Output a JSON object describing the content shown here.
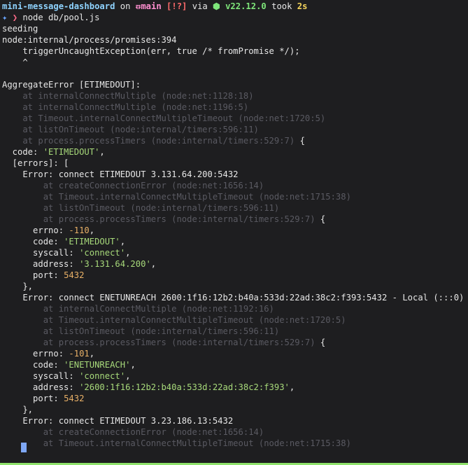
{
  "prompt": {
    "dir": "mini-message-dashboard",
    "on": " on ",
    "branch_icon": "ᵿ",
    "branch": "main",
    "status": "[!?]",
    "via": " via ",
    "node_icon": "⬢",
    "node_version": "v22.12.0",
    "took_label": " took ",
    "took": "2s",
    "star": "✦",
    "arrow": "❯",
    "command": "node db/pool.js"
  },
  "output": {
    "seeding": "seeding",
    "location": "node:internal/process/promises:394",
    "trigger": "    triggerUncaughtException(err, true /* fromPromise */);",
    "caret": "    ^",
    "blank": "",
    "aggregate": "AggregateError [ETIMEDOUT]:",
    "agg_stack": [
      "    at internalConnectMultiple (node:net:1128:18)",
      "    at internalConnectMultiple (node:net:1196:5)",
      "    at Timeout.internalConnectMultipleTimeout (node:net:1720:5)",
      "    at listOnTimeout (node:internal/timers:596:11)"
    ],
    "agg_last": "    at process.processTimers (node:internal/timers:529:7)",
    "open_brace": " {",
    "code_key": "  code: ",
    "code_val": "'ETIMEDOUT'",
    "comma": ",",
    "errors_open": "  [errors]: [",
    "err1": {
      "head": "    Error: connect ETIMEDOUT 3.131.64.200:5432",
      "stack": [
        "        at createConnectionError (node:net:1656:14)",
        "        at Timeout.internalConnectMultipleTimeout (node:net:1715:38)",
        "        at listOnTimeout (node:internal/timers:596:11)"
      ],
      "last": "        at process.processTimers (node:internal/timers:529:7)",
      "errno_key": "      errno: ",
      "errno_val": "-110",
      "code_key": "      code: ",
      "code_val": "'ETIMEDOUT'",
      "syscall_key": "      syscall: ",
      "syscall_val": "'connect'",
      "address_key": "      address: ",
      "address_val": "'3.131.64.200'",
      "port_key": "      port: ",
      "port_val": "5432",
      "close": "    },"
    },
    "err2": {
      "head": "    Error: connect ENETUNREACH 2600:1f16:12b2:b40a:533d:22ad:38c2:f393:5432 - Local (:::0)",
      "stack": [
        "        at internalConnectMultiple (node:net:1192:16)",
        "        at Timeout.internalConnectMultipleTimeout (node:net:1720:5)",
        "        at listOnTimeout (node:internal/timers:596:11)"
      ],
      "last": "        at process.processTimers (node:internal/timers:529:7)",
      "errno_key": "      errno: ",
      "errno_val": "-101",
      "code_key": "      code: ",
      "code_val": "'ENETUNREACH'",
      "syscall_key": "      syscall: ",
      "syscall_val": "'connect'",
      "address_key": "      address: ",
      "address_val": "'2600:1f16:12b2:b40a:533d:22ad:38c2:f393'",
      "port_key": "      port: ",
      "port_val": "5432",
      "close": "    },"
    },
    "err3": {
      "head": "    Error: connect ETIMEDOUT 3.23.186.13:5432",
      "stack": [
        "        at createConnectionError (node:net:1656:14)",
        "        at Timeout.internalConnectMultipleTimeout (node:net:1715:38)"
      ]
    }
  }
}
